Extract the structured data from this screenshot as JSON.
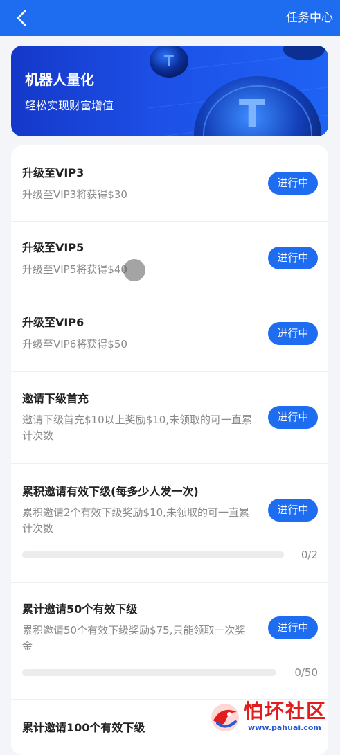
{
  "header": {
    "back_icon": "chevron-left-icon",
    "title": "任务中心"
  },
  "banner": {
    "title": "机器人量化",
    "subtitle": "轻松实现财富增值",
    "art_icon": "tether-coin-icon"
  },
  "tasks": [
    {
      "title": "升级至VIP3",
      "desc": "升级至VIP3将获得$30",
      "button": "进行中"
    },
    {
      "title": "升级至VIP5",
      "desc": "升级至VIP5将获得$40",
      "button": "进行中"
    },
    {
      "title": "升级至VIP6",
      "desc": "升级至VIP6将获得$50",
      "button": "进行中"
    },
    {
      "title": "邀请下级首充",
      "desc": "邀请下级首充$10以上奖励$10,未领取的可一直累计次数",
      "button": "进行中"
    },
    {
      "title": "累积邀请有效下级(每多少人发一次)",
      "desc": "累积邀请2个有效下级奖励$10,未领取的可一直累计次数",
      "button": "进行中",
      "progress": {
        "value": 0,
        "total": 2,
        "label": "0/2"
      }
    },
    {
      "title": "累计邀请50个有效下级",
      "desc": "累积邀请50个有效下级奖励$75,只能领取一次奖金",
      "button": "进行中",
      "progress": {
        "value": 0,
        "total": 50,
        "label": "0/50"
      }
    },
    {
      "title": "累计邀请100个有效下级"
    }
  ],
  "watermark": {
    "text": "怕坏社区",
    "url": "www.pahuai.com"
  },
  "colors": {
    "primary": "#1e6cf0",
    "banner_dark": "#1438c9",
    "watermark_red": "#e11d1d"
  }
}
